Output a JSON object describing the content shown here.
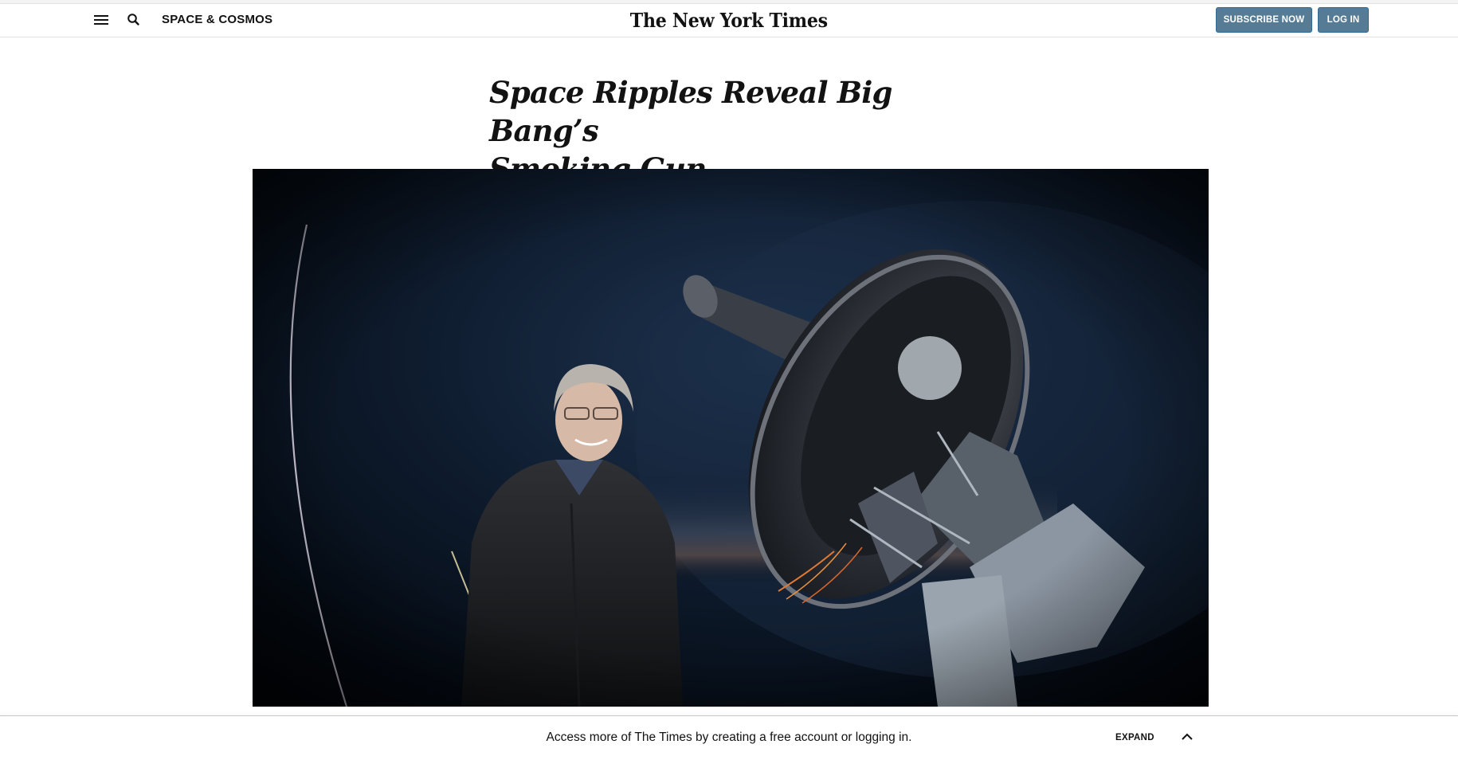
{
  "header": {
    "menu_icon": "hamburger-menu-icon",
    "search_icon": "search-icon",
    "section": "SPACE & COSMOS",
    "logo": "The New York Times",
    "subscribe_label": "SUBSCRIBE NOW",
    "login_label": "LOG IN",
    "accent_color": "#567b95"
  },
  "article": {
    "headline_line1": "Space Ripples Reveal Big Bang’s",
    "headline_line2": "Smoking Gun"
  },
  "bottom_bar": {
    "message": "Access more of The Times by creating a free account or logging in.",
    "expand_label": "EXPAND",
    "chevron_icon": "chevron-up-icon"
  }
}
